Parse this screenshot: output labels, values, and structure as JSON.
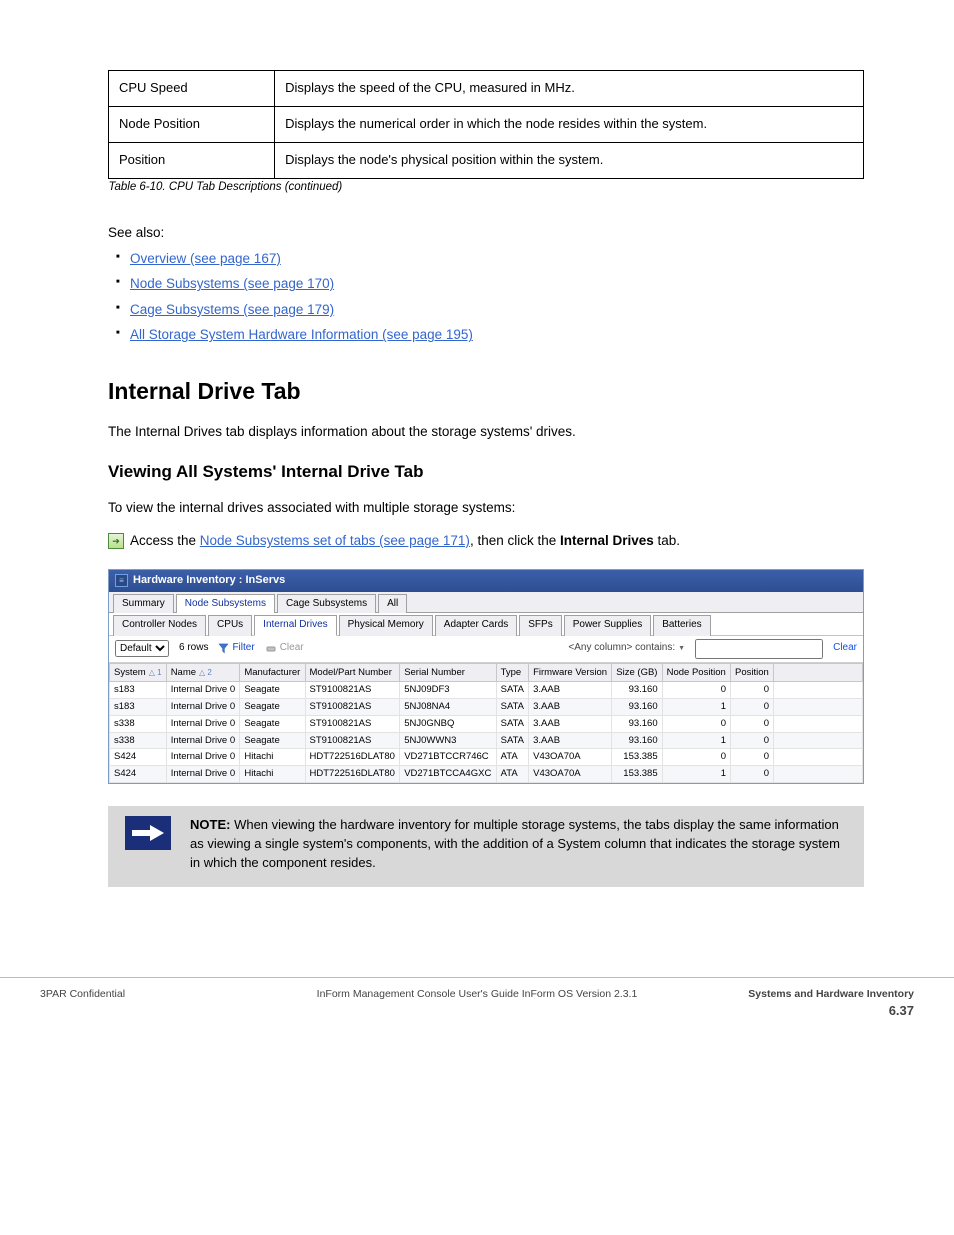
{
  "def_table": {
    "caption": "Table 6-10.  CPU Tab Descriptions (continued)",
    "rows": [
      {
        "term": "CPU Speed",
        "def": "Displays the speed of the CPU, measured in MHz."
      },
      {
        "term": "Node Position",
        "def": "Displays the numerical order in which the node resides within the system."
      },
      {
        "term": "Position",
        "def": "Displays the node's physical position within the system."
      }
    ]
  },
  "see_also_label": "See also:",
  "see_also_items": [
    "Overview (see page 167)",
    "Node Subsystems (see page 170)",
    "Cage Subsystems (see page 179)",
    "All Storage System Hardware Information (see page 195)"
  ],
  "section_heading": "Internal Drive Tab",
  "section_para1": "The Internal Drives tab displays information about the storage systems' drives.",
  "section_sub": "Viewing All Systems' Internal Drive Tab",
  "section_para2": "To view the internal drives associated with multiple storage systems:",
  "step_text_a": "Access the ",
  "step_text_link": "Node Subsystems set of tabs (see page 171)",
  "step_text_b": ", then click the ",
  "step_text_bold": "Internal Drives",
  "step_text_c": " tab.",
  "ui": {
    "title": "Hardware Inventory : InServs",
    "main_tabs": [
      "Summary",
      "Node Subsystems",
      "Cage Subsystems",
      "All"
    ],
    "main_active": 1,
    "sub_tabs": [
      "Controller Nodes",
      "CPUs",
      "Internal Drives",
      "Physical Memory",
      "Adapter Cards",
      "SFPs",
      "Power Supplies",
      "Batteries"
    ],
    "sub_active": 2,
    "filter": {
      "view_select": "Default",
      "rowcount": "6 rows",
      "filter_btn": "Filter",
      "clear_btn": "Clear",
      "match_label": "<Any column> contains:",
      "match_value": "",
      "clear_link": "Clear"
    },
    "columns": [
      "System",
      "Name",
      "Manufacturer",
      "Model/Part Number",
      "Serial Number",
      "Type",
      "Firmware Version",
      "Size (GB)",
      "Node Position",
      "Position"
    ],
    "sort": {
      "primary": 0,
      "secondary": 1
    },
    "rows": [
      {
        "system": "s183",
        "name": "Internal Drive 0",
        "manufacturer": "Seagate",
        "model": "ST9100821AS",
        "serial": "5NJ09DF3",
        "type": "SATA",
        "fw": "3.AAB",
        "size": "93.160",
        "npos": "0",
        "pos": "0"
      },
      {
        "system": "s183",
        "name": "Internal Drive 0",
        "manufacturer": "Seagate",
        "model": "ST9100821AS",
        "serial": "5NJ08NA4",
        "type": "SATA",
        "fw": "3.AAB",
        "size": "93.160",
        "npos": "1",
        "pos": "0"
      },
      {
        "system": "s338",
        "name": "Internal Drive 0",
        "manufacturer": "Seagate",
        "model": "ST9100821AS",
        "serial": "5NJ0GNBQ",
        "type": "SATA",
        "fw": "3.AAB",
        "size": "93.160",
        "npos": "0",
        "pos": "0"
      },
      {
        "system": "s338",
        "name": "Internal Drive 0",
        "manufacturer": "Seagate",
        "model": "ST9100821AS",
        "serial": "5NJ0WWN3",
        "type": "SATA",
        "fw": "3.AAB",
        "size": "93.160",
        "npos": "1",
        "pos": "0"
      },
      {
        "system": "S424",
        "name": "Internal Drive 0",
        "manufacturer": "Hitachi",
        "model": "HDT722516DLAT80",
        "serial": "VD271BTCCR746C",
        "type": "ATA",
        "fw": "V43OA70A",
        "size": "153.385",
        "npos": "0",
        "pos": "0"
      },
      {
        "system": "S424",
        "name": "Internal Drive 0",
        "manufacturer": "Hitachi",
        "model": "HDT722516DLAT80",
        "serial": "VD271BTCCA4GXC",
        "type": "ATA",
        "fw": "V43OA70A",
        "size": "153.385",
        "npos": "1",
        "pos": "0"
      }
    ]
  },
  "note": {
    "lead": "NOTE:",
    "body": " When viewing the hardware inventory for multiple storage systems, the tabs display the same information as viewing a single system's components, with the addition of a System column that indicates the storage system in which the component resides."
  },
  "footer": {
    "left": "3PAR Confidential",
    "chapter": "Systems and Hardware Inventory",
    "right_sub": "6.37",
    "center": "InForm Management Console User's Guide InForm OS Version 2.3.1"
  }
}
